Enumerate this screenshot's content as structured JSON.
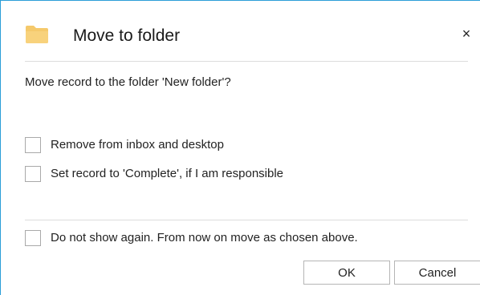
{
  "dialog": {
    "title": "Move to folder",
    "close_symbol": "×",
    "icon": "folder-icon",
    "question": "Move record to the folder 'New folder'?",
    "options": [
      {
        "label": "Remove from inbox and desktop",
        "checked": false
      },
      {
        "label": "Set record to 'Complete', if I am responsible",
        "checked": false
      }
    ],
    "dont_show_again": {
      "label": "Do not show again. From now on move as chosen above.",
      "checked": false
    },
    "buttons": {
      "ok": "OK",
      "cancel": "Cancel"
    }
  },
  "colors": {
    "accent_border": "#2b9ed8",
    "folder_icon": "#f5c96b",
    "divider": "#dcdcdc"
  }
}
